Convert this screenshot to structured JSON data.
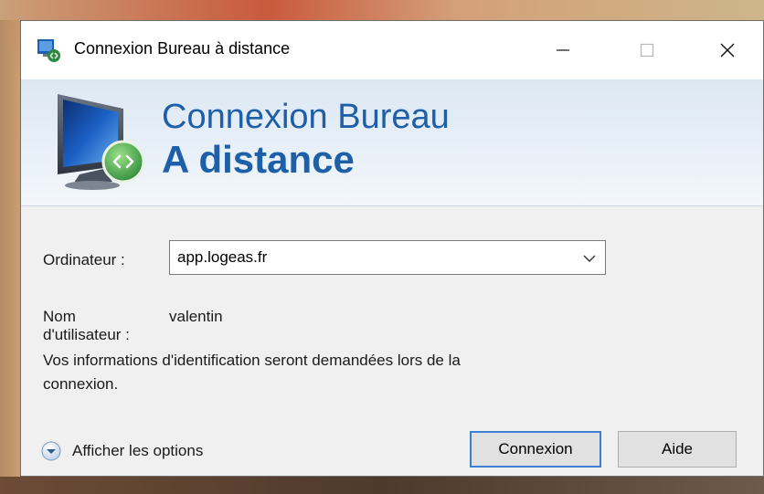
{
  "window": {
    "title": "Connexion Bureau à distance"
  },
  "banner": {
    "line1": "Connexion Bureau",
    "line2": "A distance"
  },
  "form": {
    "computer_label": "Ordinateur :",
    "computer_value": "app.logeas.fr",
    "username_label_line1": "Nom",
    "username_label_line2": "d'utilisateur :",
    "username_value": "valentin",
    "info_line1": "Vos informations d'identification seront demandées lors de la",
    "info_line2": "connexion."
  },
  "footer": {
    "options_label": "Afficher les options",
    "connect_label": "Connexion",
    "help_label": "Aide"
  },
  "icons": {
    "title": "remote-desktop-icon",
    "banner": "remote-desktop-monitor-icon",
    "minimize": "minimize-icon",
    "maximize": "maximize-icon",
    "close": "close-icon",
    "dropdown": "chevron-down-icon",
    "options": "expand-circle-icon"
  },
  "colors": {
    "accent": "#1d5fa8",
    "focus_border": "#3c7fd1",
    "banner_bg": "#e4edf6"
  }
}
